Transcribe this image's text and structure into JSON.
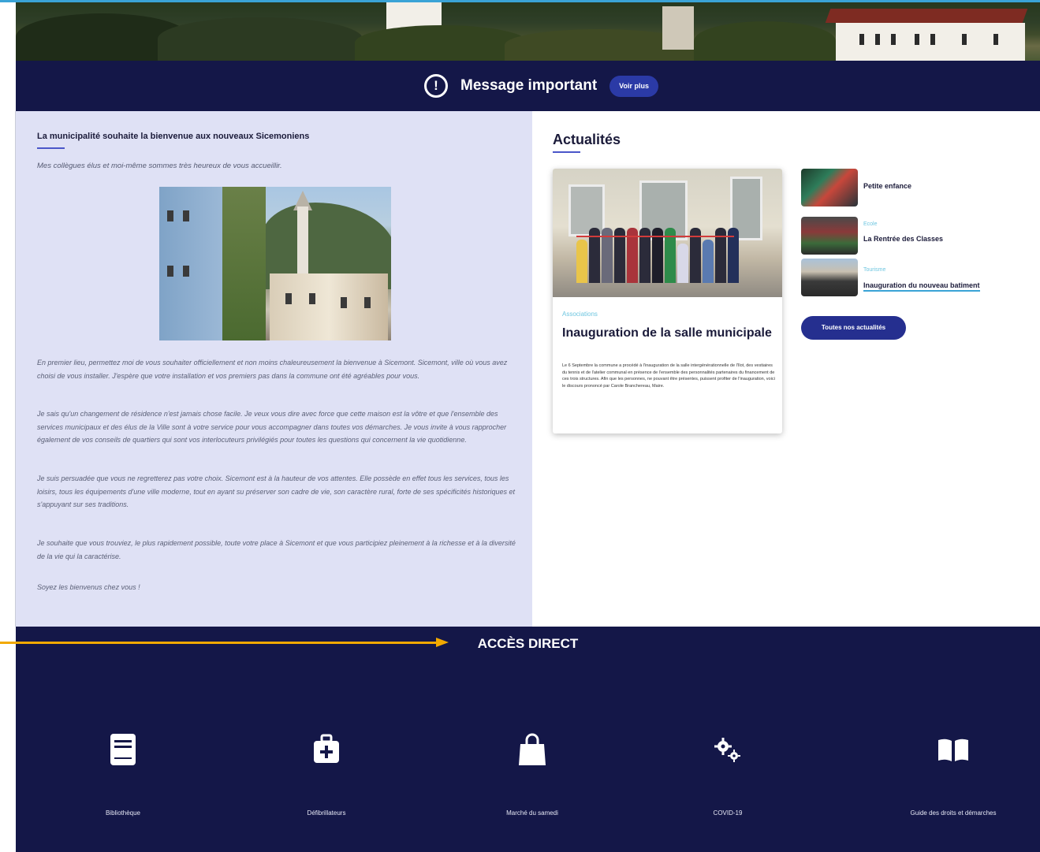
{
  "message_bar": {
    "title": "Message important",
    "button_label": "Voir plus"
  },
  "welcome": {
    "title": "La municipalité souhaite la bienvenue aux nouveaux Sicemoniens",
    "intro": "Mes collègues élus et moi-même sommes très heureux de vous accueillir.",
    "paragraphs": [
      "En premier lieu, permettez moi de vous souhaiter officiellement et non moins chaleureusement la bienvenue à Sicemont. Sicemont, ville où vous avez choisi de vous installer. J'espère que votre installation et vos premiers pas dans la commune ont été agréables pour vous.",
      "Je sais qu'un changement de résidence n'est jamais chose facile. Je veux vous dire avec force que cette maison est la vôtre et que l'ensemble des services municipaux et des élus de la Ville sont à votre service pour vous accompagner dans toutes vos démarches. Je vous invite à vous rapprocher également de vos conseils de quartiers qui sont vos interlocuteurs privilégiés pour toutes les questions qui concernent la vie quotidienne.",
      "Je suis persuadée que vous ne regretterez pas votre choix. Sicemont est à la hauteur de vos attentes. Elle possède en effet tous les services, tous les loisirs, tous les équipements d'une ville moderne, tout en ayant su préserver son cadre de vie, son caractère rural, forte de ses spécificités historiques et s'appuyant sur ses traditions.",
      "Je souhaite que vous trouviez, le plus rapidement possible, toute votre place à Sicemont et que vous participiez pleinement à la richesse et à la diversité de la vie qui la caractérise.",
      "Soyez les bienvenus chez vous !"
    ]
  },
  "news": {
    "title": "Actualités",
    "featured": {
      "category": "Associations",
      "title": "Inauguration de la salle municipale",
      "text": "Le 6 Septembre la commune a procédé à l'inauguration de la salle intergénérationnelle de l'Ilot, des vestiaires du tennis et de l'atelier communal en présence de l'ensemble des personnalités partenaires du financement de ces trois structures. Afin que les personnes, ne pouvant être présentes, puissent profiter de l'inauguration, voici le discours prononcé par Carole Branchereau, Maire."
    },
    "items": [
      {
        "category": "",
        "label": "Petite enfance"
      },
      {
        "category": "Ecole",
        "label": "La Rentrée des Classes"
      },
      {
        "category": "Tourisme",
        "label": "Inauguration du nouveau batiment"
      }
    ],
    "all_button": "Toutes nos actualités"
  },
  "acces": {
    "title": "ACCÈS DIRECT",
    "items": [
      {
        "label": "Bibliothèque",
        "icon": "book-icon"
      },
      {
        "label": "Défibrillateurs",
        "icon": "first-aid-kit-icon"
      },
      {
        "label": "Marché du samedi",
        "icon": "shopping-bag-icon"
      },
      {
        "label": "COVID-19",
        "icon": "gears-icon"
      },
      {
        "label": "Guide des droits et démarches",
        "icon": "open-book-icon"
      }
    ]
  },
  "colors": {
    "navy": "#141748",
    "accent_blue": "#2b3aa6",
    "light_panel": "#dfe1f5",
    "arrow": "#f2a900",
    "category_cyan": "#6ec6e0"
  }
}
